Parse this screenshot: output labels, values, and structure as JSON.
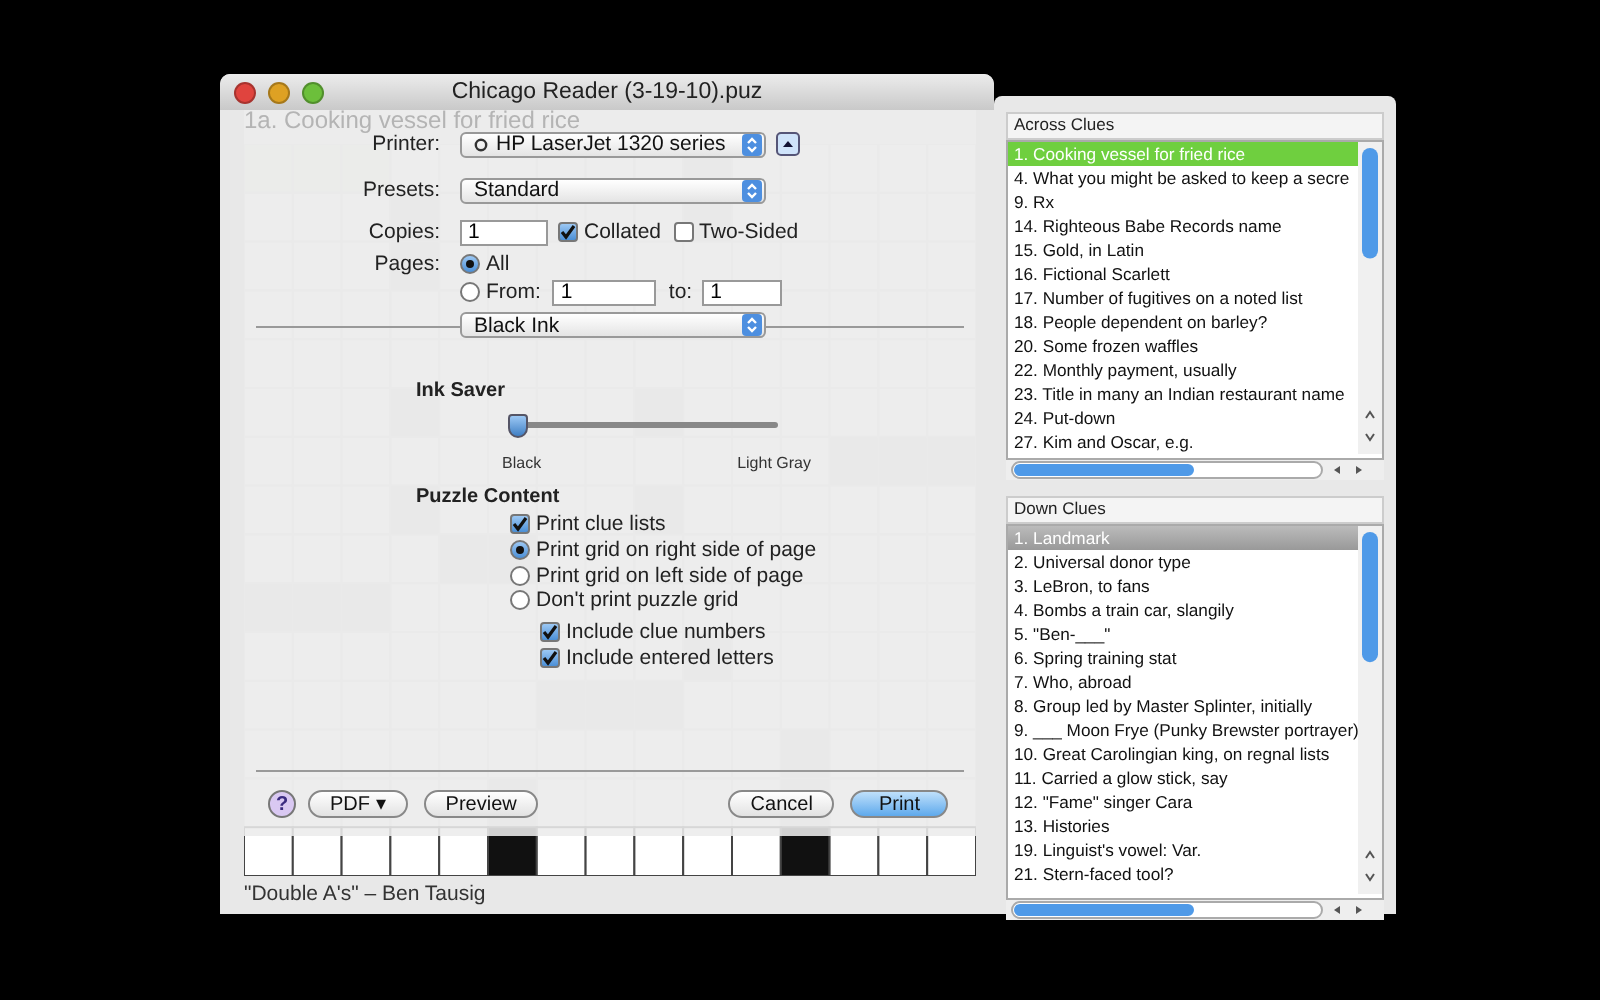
{
  "window": {
    "title": "Chicago Reader (3-19-10).puz"
  },
  "clue_heading": "1a. Cooking vessel for fried rice",
  "print_sheet": {
    "printer": {
      "label": "Printer:",
      "value": "HP LaserJet 1320 series"
    },
    "presets": {
      "label": "Presets:",
      "value": "Standard"
    },
    "copies": {
      "label": "Copies:",
      "value": "1",
      "collated": {
        "label": "Collated",
        "checked": true
      },
      "two_sided": {
        "label": "Two-Sided",
        "checked": false
      }
    },
    "pages": {
      "label": "Pages:",
      "options": [
        {
          "label": "All",
          "selected": true
        },
        {
          "label": "From:",
          "selected": false
        }
      ],
      "from": "1",
      "to_label": "to:",
      "to": "1"
    },
    "mode": {
      "value": "Black Ink"
    },
    "ink_saver": {
      "title": "Ink Saver",
      "level": 0,
      "min_label": "Black",
      "max_label": "Light Gray"
    },
    "puzzle_content": {
      "title": "Puzzle Content",
      "print_clue_lists": {
        "label": "Print clue lists",
        "checked": true
      },
      "grid_options": [
        {
          "label": "Print grid on right side of page",
          "selected": true
        },
        {
          "label": "Print grid on left side of page",
          "selected": false
        },
        {
          "label": "Don't print puzzle grid",
          "selected": false
        }
      ],
      "include": [
        {
          "label": "Include clue numbers",
          "checked": true
        },
        {
          "label": "Include entered letters",
          "checked": true
        }
      ]
    },
    "buttons": {
      "help": "?",
      "pdf": "PDF ▾",
      "preview": "Preview",
      "cancel": "Cancel",
      "print": "Print"
    }
  },
  "author": "\"Double A's\" – Ben Tausig",
  "across_clues": {
    "title": "Across Clues",
    "items": [
      {
        "text": "1. Cooking vessel for fried rice",
        "selected": true
      },
      {
        "text": "4. What you might be asked to keep a secre",
        "selected": false
      },
      {
        "text": "9. Rx",
        "selected": false
      },
      {
        "text": "14. Righteous Babe Records name",
        "selected": false
      },
      {
        "text": "15. Gold, in Latin",
        "selected": false
      },
      {
        "text": "16. Fictional Scarlett",
        "selected": false
      },
      {
        "text": "17. Number of fugitives on a noted list",
        "selected": false
      },
      {
        "text": "18. People dependent on barley?",
        "selected": false
      },
      {
        "text": "20. Some frozen waffles",
        "selected": false
      },
      {
        "text": "22. Monthly payment, usually",
        "selected": false
      },
      {
        "text": "23. Title in many an Indian restaurant name",
        "selected": false
      },
      {
        "text": "24. Put-down",
        "selected": false
      },
      {
        "text": "27. Kim and Oscar, e.g.",
        "selected": false
      }
    ]
  },
  "down_clues": {
    "title": "Down Clues",
    "items": [
      {
        "text": "1. Landmark",
        "selected": true
      },
      {
        "text": "2. Universal donor type",
        "selected": false
      },
      {
        "text": "3. LeBron, to fans",
        "selected": false
      },
      {
        "text": "4. Bombs a train car, slangily",
        "selected": false
      },
      {
        "text": "5. \"Ben-___\"",
        "selected": false
      },
      {
        "text": "6. Spring training stat",
        "selected": false
      },
      {
        "text": "7. Who, abroad",
        "selected": false
      },
      {
        "text": "8. Group led by Master Splinter, initially",
        "selected": false
      },
      {
        "text": "9. ___ Moon Frye (Punky Brewster portrayer)",
        "selected": false
      },
      {
        "text": "10. Great Carolingian king, on regnal lists",
        "selected": false
      },
      {
        "text": "11. Carried a glow stick, say",
        "selected": false
      },
      {
        "text": "12. \"Fame\" singer Cara",
        "selected": false
      },
      {
        "text": "13. Histories",
        "selected": false
      },
      {
        "text": "19. Linguist's vowel: Var.",
        "selected": false
      },
      {
        "text": "21. Stern-faced tool?",
        "selected": false
      }
    ]
  }
}
